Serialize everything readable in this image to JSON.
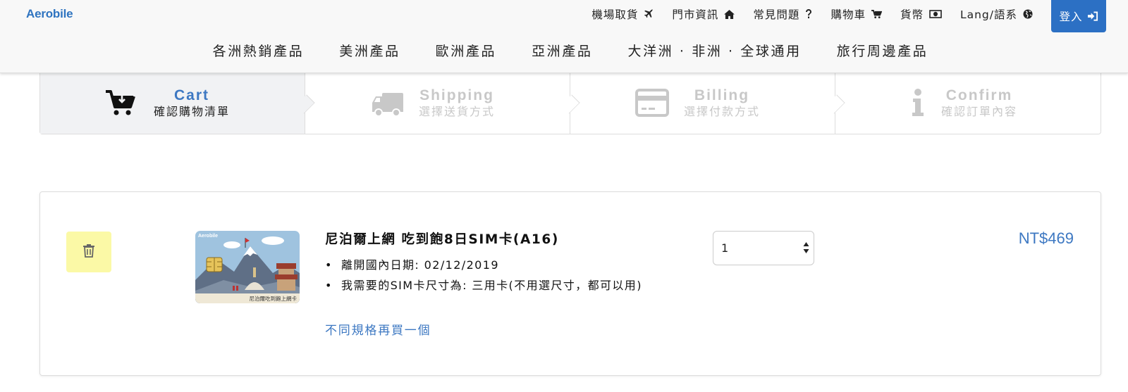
{
  "brand": {
    "logo_text": "Aerobile",
    "accent_color": "#2c70c4",
    "link_color": "#3d78c2"
  },
  "topnav": {
    "items": [
      {
        "label": "機場取貨",
        "icon": "plane-icon"
      },
      {
        "label": "門市資訊",
        "icon": "home-icon"
      },
      {
        "label": "常見問題",
        "icon": "question-icon"
      },
      {
        "label": "購物車",
        "icon": "cart-icon"
      },
      {
        "label": "貨幣",
        "icon": "money-icon"
      },
      {
        "label": "Lang/語系",
        "icon": "globe-icon"
      }
    ],
    "login_label": "登入",
    "login_icon": "sign-in-icon"
  },
  "mainnav": {
    "items": [
      "各洲熱銷產品",
      "美洲產品",
      "歐洲產品",
      "亞洲產品",
      "大洋洲 · 非洲 · 全球通用",
      "旅行周邊產品"
    ]
  },
  "steps": [
    {
      "en": "Cart",
      "zh": "確認購物清單",
      "icon": "cart-download-icon",
      "active": true
    },
    {
      "en": "Shipping",
      "zh": "選擇送貨方式",
      "icon": "truck-icon",
      "active": false
    },
    {
      "en": "Billing",
      "zh": "選擇付款方式",
      "icon": "credit-card-icon",
      "active": false
    },
    {
      "en": "Confirm",
      "zh": "確認訂單內容",
      "icon": "info-icon",
      "active": false
    }
  ],
  "cart": {
    "item": {
      "name": "尼泊爾上網 吃到飽8日SIM卡(A16)",
      "options": [
        "離開國內日期: 02/12/2019",
        "我需要的SIM卡尺寸為: 三用卡(不用選尺寸，都可以用)"
      ],
      "buy_again_label": "不同規格再買一個",
      "quantity": "1",
      "price": "NT$469",
      "thumbnail": {
        "brand": "Aerobile",
        "caption": "尼泊爾吃到飽上網卡"
      },
      "delete_icon": "trash-icon"
    }
  }
}
